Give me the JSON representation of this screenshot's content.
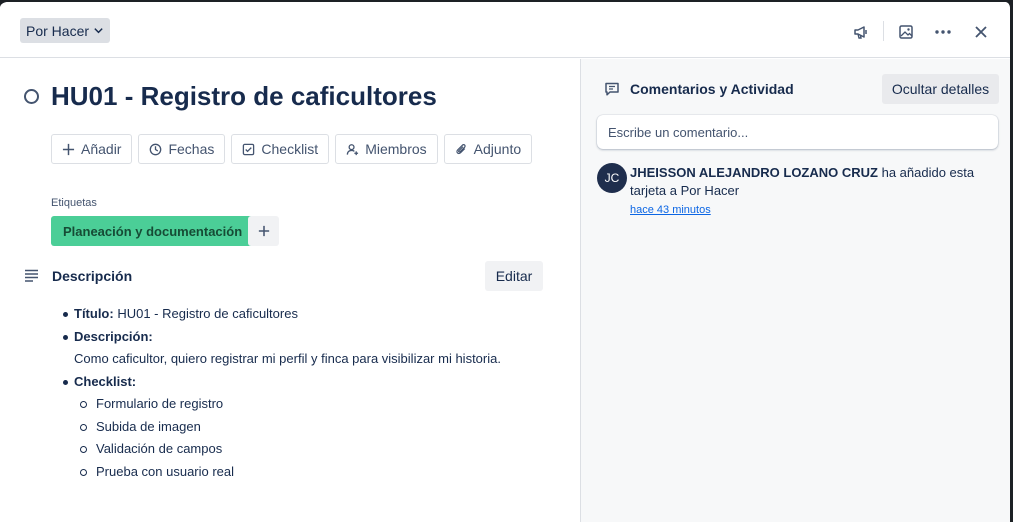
{
  "header": {
    "list_name": "Por Hacer"
  },
  "card": {
    "title": "HU01 - Registro de caficultores",
    "actions": [
      "Añadir",
      "Fechas",
      "Checklist",
      "Miembros",
      "Adjunto"
    ],
    "labels_title": "Etiquetas",
    "labels": [
      {
        "name": "Planeación y documentación",
        "color": "#4bce97"
      }
    ],
    "description": {
      "title": "Descripción",
      "edit_label": "Editar",
      "items": {
        "titulo_key": "Título:",
        "titulo_value": " HU01 - Registro de caficultores",
        "desc_key": "Descripción:",
        "desc_value": "Como caficultor, quiero registrar mi perfil y finca para visibilizar mi historia.",
        "checklist_key": "Checklist:",
        "checklist_items": [
          "Formulario de registro",
          "Subida de imagen",
          "Validación de campos",
          "Prueba con usuario real"
        ]
      }
    }
  },
  "activity": {
    "title": "Comentarios y Actividad",
    "hide_label": "Ocultar detalles",
    "comment_placeholder": "Escribe un comentario...",
    "entries": [
      {
        "avatar_initials": "JC",
        "user": "JHEISSON ALEJANDRO LOZANO CRUZ",
        "text": " ha añadido esta tarjeta a Por Hacer",
        "time": "hace 43 minutos"
      }
    ]
  },
  "icons": {
    "status": "circle-icon",
    "announce": "megaphone-icon",
    "cover": "image-icon",
    "more": "more-icon",
    "close": "close-icon"
  }
}
